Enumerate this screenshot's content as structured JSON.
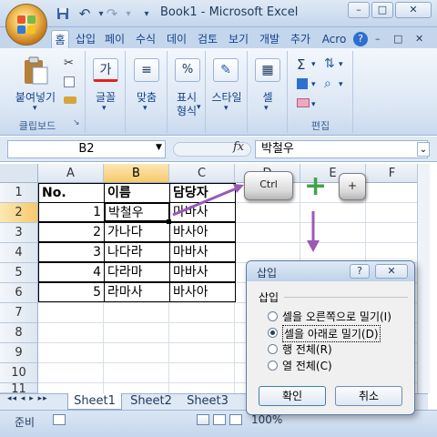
{
  "window": {
    "title": "Book1 - Microsoft Excel",
    "min_label": "–",
    "max_label": "□",
    "close_label": "✕"
  },
  "qat": {
    "save_icon": "save-icon",
    "undo_label": "↶",
    "redo_label": "↷",
    "more_label": "▾"
  },
  "ribbon": {
    "tabs": [
      "홈",
      "삽입",
      "페이",
      "수식",
      "데이",
      "검토",
      "보기",
      "개발",
      "추가",
      "Acro"
    ],
    "active_tab": "홈",
    "help_label": "?",
    "groups": {
      "clipboard": {
        "label": "클립보드",
        "paste_label": "붙여넣기",
        "launcher": "↘"
      },
      "font": {
        "label": "글꼴",
        "icon_text": "가"
      },
      "align": {
        "label": "맞춤"
      },
      "number": {
        "label_line1": "표시",
        "label_line2": "형식",
        "icon_text": "%"
      },
      "style": {
        "label": "스타일"
      },
      "cells": {
        "label": "셀"
      },
      "editing": {
        "label": "편집",
        "sum_icon": "Σ"
      }
    }
  },
  "formula_bar": {
    "name_box": "B2",
    "fx_label": "fx",
    "value": "박철우"
  },
  "grid": {
    "columns": [
      "A",
      "B",
      "C",
      "D",
      "E",
      "F"
    ],
    "selected_column": "B",
    "rows": [
      "1",
      "2",
      "3",
      "4",
      "5",
      "6",
      "7",
      "8",
      "9",
      "10",
      "11"
    ],
    "selected_row": "2",
    "cells": [
      {
        "a": "No.",
        "b": "이름",
        "c": "담당자"
      },
      {
        "a": "1",
        "b": "박철우",
        "c": "마바사"
      },
      {
        "a": "2",
        "b": "가나다",
        "c": "바사아"
      },
      {
        "a": "3",
        "b": "나다라",
        "c": "마바사"
      },
      {
        "a": "4",
        "b": "다라마",
        "c": "마바사"
      },
      {
        "a": "5",
        "b": "라마사",
        "c": "바사아"
      }
    ]
  },
  "sheets": {
    "tabs": [
      "Sheet1",
      "Sheet2",
      "Sheet3"
    ],
    "active": "Sheet1",
    "nav": "◂◂ ◂ ▸ ▸▸"
  },
  "status": {
    "ready": "준비",
    "zoom": "100%"
  },
  "overlay": {
    "key_ctrl": "Ctrl",
    "plus": "+",
    "key_plus": "+",
    "arrow": "arrow"
  },
  "dialog": {
    "title": "삽입",
    "help_label": "?",
    "close_label": "✕",
    "group_label": "삽입",
    "options": [
      "셀을 오른쪽으로 밀기(I)",
      "셀을 아래로 밀기(D)",
      "행 전체(R)",
      "열 전체(C)"
    ],
    "selected_option": 1,
    "ok_label": "확인",
    "cancel_label": "취소"
  }
}
